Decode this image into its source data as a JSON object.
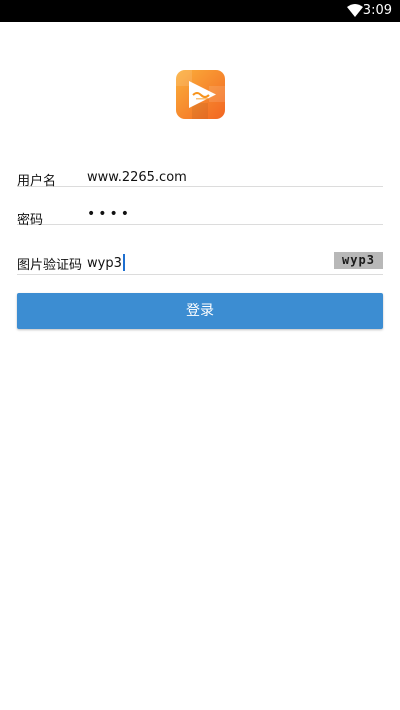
{
  "status_bar": {
    "time": "3:09",
    "icons": [
      "wifi-icon",
      "battery-icon"
    ]
  },
  "app_logo": {
    "icon": "app-logo-play-icon",
    "colors": [
      "#f7941d",
      "#ffffff"
    ]
  },
  "form": {
    "username": {
      "label": "用户名",
      "value": "www.2265.com"
    },
    "password": {
      "label": "密码",
      "masked_value": "••••"
    },
    "captcha": {
      "label": "图片验证码",
      "value": "wyp3",
      "image_text": "wyp3"
    }
  },
  "login_button": {
    "label": "登录",
    "color": "#3c8dd2"
  }
}
